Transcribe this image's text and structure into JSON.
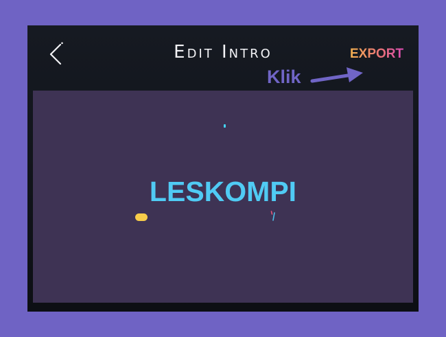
{
  "header": {
    "title": "Edit Intro",
    "export_label": "EXPORT",
    "back_icon": "chevron-left-icon"
  },
  "annotation": {
    "label": "Klik",
    "arrow_icon": "arrow-right-icon",
    "color": "#7065c6"
  },
  "preview": {
    "intro_text": "LESKOMPI",
    "text_color": "#50cbf4",
    "background_color": "#3e3354"
  },
  "colors": {
    "page_background": "#6f63c4",
    "app_background": "#12151c",
    "export_gradient": [
      "#f3b150",
      "#d94bb4"
    ],
    "accent_yellow": "#f7cc4a"
  }
}
